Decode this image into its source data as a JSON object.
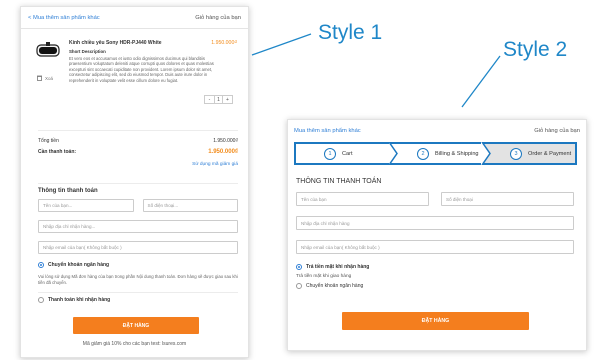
{
  "style1": {
    "label": "Style 1",
    "back_link": "< Mua thêm sản phẩm khác",
    "cart_title": "Giỏ hàng của bạn",
    "product": {
      "name": "Kính chiều yêu Sony HDR-PJ440 White",
      "price": "1.950.000₫",
      "desc_title": "Short Description",
      "description": "Et vero eos et accusamus et iusto odio dignissimos ducimus qui blanditiis praesentium voluptatum deleniti atque corrupti quos dolores et quas molestias excepturi sint occaecati cupiditate non provident. Lorem ipsum dolor sit amet, consectetur adipiscing elit, sed do eiusmod tempor. Duis aute irure dolor in reprehenderit in voluptate velit esse cillum dolore eu fugiat.",
      "delete_label": "Xoá",
      "qty": "1",
      "minus": "-",
      "plus": "+"
    },
    "totals": {
      "total_label": "Tổng tiền",
      "total_value": "1.950.000₫",
      "pay_label": "Cần thanh toán:",
      "pay_value": "1.950.000₫",
      "coupon_link": "Sử dụng mã giảm giá"
    },
    "form": {
      "title": "Thông tin thanh toán",
      "name_ph": "Tên của bạn...",
      "phone_ph": "Số điện thoại...",
      "address_ph": "Nhập địa chỉ nhận hàng...",
      "email_ph": "Nhập email của bạn( Không bắt buộc )",
      "option_bank": "Chuyển khoản ngân hàng",
      "bank_note": "Vui lòng sử dụng Mã đơn hàng của bạn trong phần Nội dung thanh toán. Đơn hàng sẽ được giao sau khi tiền đã chuyển.",
      "option_cod": "Thanh toán khi nhận hàng"
    },
    "order_button": "ĐẶT HÀNG",
    "footnote": "Mã giảm giá 10% cho các bạn test: lsures.com"
  },
  "style2": {
    "label": "Style 2",
    "back_link": "Mua thêm sản phẩm khác",
    "cart_title": "Giỏ hàng của bạn",
    "steps": [
      {
        "num": "1",
        "label": "Cart"
      },
      {
        "num": "2",
        "label": "Billing & Shipping"
      },
      {
        "num": "3",
        "label": "Order & Payment"
      }
    ],
    "form": {
      "title": "THÔNG TIN THANH TOÁN",
      "name_ph": "Tên của bạn",
      "phone_ph": "Số điện thoại",
      "address_ph": "Nhập địa chỉ nhận hàng",
      "email_ph": "Nhập email của bạn( Không bắt buộc )",
      "option_cash": "Trả tiền mặt khi nhận hàng",
      "cash_sub": "Trả tiền mặt khi giao hàng",
      "option_bank": "Chuyển khoản ngân hàng"
    },
    "order_button": "ĐẶT HÀNG"
  },
  "colors": {
    "accent": "#1f87c8",
    "link": "#2f7fd6",
    "order": "#f47e1e",
    "price": "#f28c1c"
  }
}
